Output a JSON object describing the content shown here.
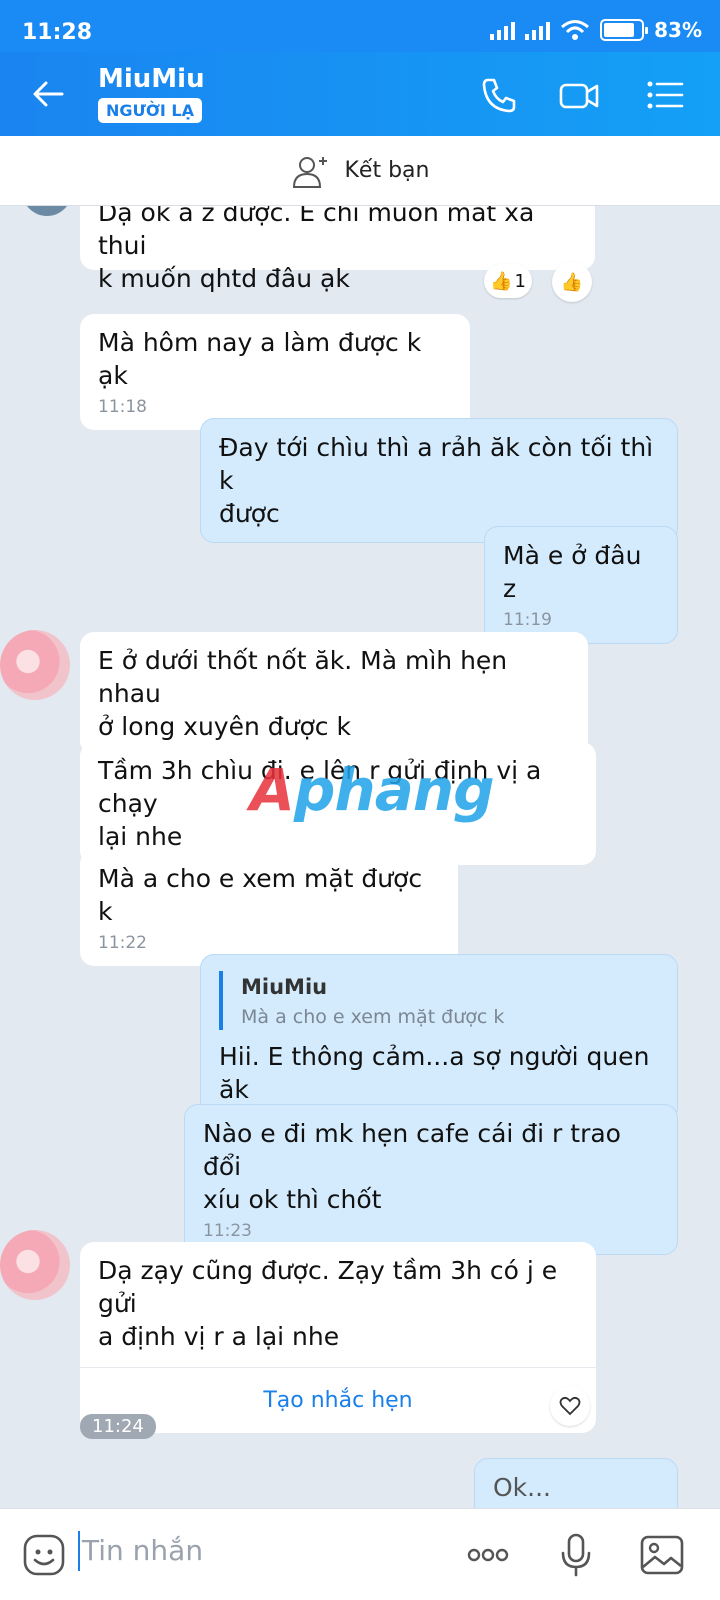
{
  "status": {
    "time": "11:28",
    "battery": "83%",
    "battery_level": 0.83
  },
  "header": {
    "title": "MiuMiu",
    "badge": "NGƯỜI LẠ"
  },
  "friend_bar": {
    "label": "Kết bạn"
  },
  "messages": [
    {
      "line1": "Dạ ok a z được. E chỉ muốn mát xa thui",
      "line2": "k muốn qhtd đâu ạk"
    },
    {
      "text": "Mà hôm nay a làm được k ạk",
      "time": "11:18"
    },
    {
      "line1": "Đay tới chìu thì a rảh ăk còn tối thì k",
      "line2": "được"
    },
    {
      "text": "Mà e ở đâu z",
      "time": "11:19"
    },
    {
      "line1": "E ở dưới thốt nốt ăk. Mà mìh hẹn nhau",
      "line2": "ở long xuyên được k"
    },
    {
      "line1": "Tầm 3h chìu đi. e lên r gửi định vị a chạy",
      "line2": "lại nhe"
    },
    {
      "text": "Mà a cho e xem mặt được k",
      "time": "11:22"
    },
    {
      "reply_name": "MiuMiu",
      "reply_quote": "Mà a cho e xem mặt được k",
      "text": "Hii. E thông cảm...a sợ người quen ăk"
    },
    {
      "line1": "Nào e đi mk hẹn cafe cái đi r trao đổi",
      "line2": "xíu ok thì chốt",
      "time": "11:23"
    },
    {
      "line1": "Dạ zạy cũng được. Zạy tầm 3h có j e gửi",
      "line2": "a định vị r a lại nhe",
      "action": "Tạo nhắc hẹn"
    }
  ],
  "reaction": {
    "count": "1"
  },
  "time_pill": "11:24",
  "watermark": {
    "part1": "A",
    "part2": "phang"
  },
  "input": {
    "placeholder": "Tin nhắn"
  },
  "partial_msg": "Ok..."
}
